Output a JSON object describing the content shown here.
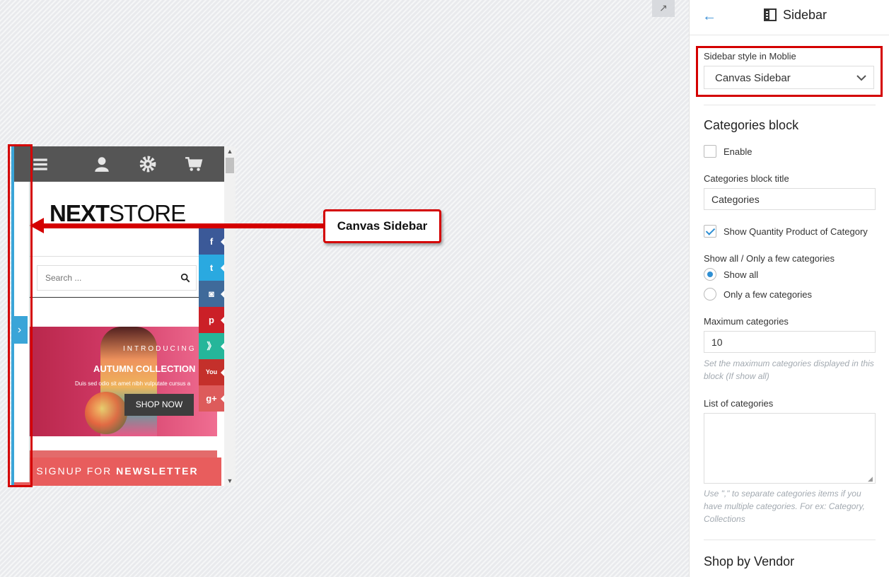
{
  "preview": {
    "corner_button_glyph": "↗",
    "logo": {
      "bold": "NEXT",
      "light": "STORE"
    },
    "search_placeholder": "Search ...",
    "socials": [
      {
        "icon": "facebook-icon",
        "glyph": "f",
        "color": "#3b5998"
      },
      {
        "icon": "twitter-icon",
        "glyph": "t",
        "color": "#2aa9e0"
      },
      {
        "icon": "instagram-icon",
        "glyph": "◙",
        "color": "#3f6a9a"
      },
      {
        "icon": "pinterest-icon",
        "glyph": "p",
        "color": "#cb2027"
      },
      {
        "icon": "rss-icon",
        "glyph": "》",
        "color": "#25b69a"
      },
      {
        "icon": "youtube-icon",
        "glyph": "You",
        "color": "#c4302b"
      },
      {
        "icon": "google-plus-icon",
        "glyph": "g+",
        "color": "#dd5b5b"
      }
    ],
    "banner": {
      "intro": "INTRODUCING",
      "title": "AUTUMN COLLECTION",
      "description": "Duis sed odio sit amet nibh vulputate cursus a",
      "button": "SHOP NOW"
    },
    "newsletter": {
      "prefix": "SIGNUP FOR ",
      "bold": "NEWSLETTER"
    },
    "handle_glyph": "›"
  },
  "annotation": {
    "callout_label": "Canvas Sidebar",
    "accent": "#d40000"
  },
  "panel": {
    "title": "Sidebar",
    "back_glyph": "←",
    "sidebar_style": {
      "label": "Sidebar style in Moblie",
      "value": "Canvas Sidebar"
    },
    "categories": {
      "heading": "Categories block",
      "enable_label": "Enable",
      "enable_checked": false,
      "title_label": "Categories block title",
      "title_value": "Categories",
      "show_quantity_label": "Show Quantity Product of Category",
      "show_quantity_checked": true,
      "show_mode_label": "Show all / Only a few categories",
      "show_all_label": "Show all",
      "only_few_label": "Only a few categories",
      "max_label": "Maximum categories",
      "max_value": "10",
      "max_help": "Set the maximum categories displayed in this block (If show all)",
      "list_label": "List of categories",
      "list_help": "Use \",\" to separate categories items if you have multiple categories. For ex: Category, Collections"
    },
    "vendor_heading": "Shop by Vendor"
  }
}
